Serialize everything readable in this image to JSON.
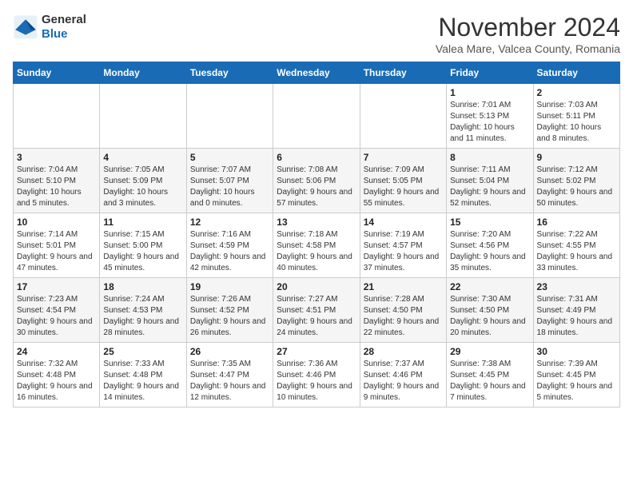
{
  "header": {
    "logo_line1": "General",
    "logo_line2": "Blue",
    "month_title": "November 2024",
    "location": "Valea Mare, Valcea County, Romania"
  },
  "weekdays": [
    "Sunday",
    "Monday",
    "Tuesday",
    "Wednesday",
    "Thursday",
    "Friday",
    "Saturday"
  ],
  "weeks": [
    [
      {
        "day": "",
        "info": ""
      },
      {
        "day": "",
        "info": ""
      },
      {
        "day": "",
        "info": ""
      },
      {
        "day": "",
        "info": ""
      },
      {
        "day": "",
        "info": ""
      },
      {
        "day": "1",
        "info": "Sunrise: 7:01 AM\nSunset: 5:13 PM\nDaylight: 10 hours and 11 minutes."
      },
      {
        "day": "2",
        "info": "Sunrise: 7:03 AM\nSunset: 5:11 PM\nDaylight: 10 hours and 8 minutes."
      }
    ],
    [
      {
        "day": "3",
        "info": "Sunrise: 7:04 AM\nSunset: 5:10 PM\nDaylight: 10 hours and 5 minutes."
      },
      {
        "day": "4",
        "info": "Sunrise: 7:05 AM\nSunset: 5:09 PM\nDaylight: 10 hours and 3 minutes."
      },
      {
        "day": "5",
        "info": "Sunrise: 7:07 AM\nSunset: 5:07 PM\nDaylight: 10 hours and 0 minutes."
      },
      {
        "day": "6",
        "info": "Sunrise: 7:08 AM\nSunset: 5:06 PM\nDaylight: 9 hours and 57 minutes."
      },
      {
        "day": "7",
        "info": "Sunrise: 7:09 AM\nSunset: 5:05 PM\nDaylight: 9 hours and 55 minutes."
      },
      {
        "day": "8",
        "info": "Sunrise: 7:11 AM\nSunset: 5:04 PM\nDaylight: 9 hours and 52 minutes."
      },
      {
        "day": "9",
        "info": "Sunrise: 7:12 AM\nSunset: 5:02 PM\nDaylight: 9 hours and 50 minutes."
      }
    ],
    [
      {
        "day": "10",
        "info": "Sunrise: 7:14 AM\nSunset: 5:01 PM\nDaylight: 9 hours and 47 minutes."
      },
      {
        "day": "11",
        "info": "Sunrise: 7:15 AM\nSunset: 5:00 PM\nDaylight: 9 hours and 45 minutes."
      },
      {
        "day": "12",
        "info": "Sunrise: 7:16 AM\nSunset: 4:59 PM\nDaylight: 9 hours and 42 minutes."
      },
      {
        "day": "13",
        "info": "Sunrise: 7:18 AM\nSunset: 4:58 PM\nDaylight: 9 hours and 40 minutes."
      },
      {
        "day": "14",
        "info": "Sunrise: 7:19 AM\nSunset: 4:57 PM\nDaylight: 9 hours and 37 minutes."
      },
      {
        "day": "15",
        "info": "Sunrise: 7:20 AM\nSunset: 4:56 PM\nDaylight: 9 hours and 35 minutes."
      },
      {
        "day": "16",
        "info": "Sunrise: 7:22 AM\nSunset: 4:55 PM\nDaylight: 9 hours and 33 minutes."
      }
    ],
    [
      {
        "day": "17",
        "info": "Sunrise: 7:23 AM\nSunset: 4:54 PM\nDaylight: 9 hours and 30 minutes."
      },
      {
        "day": "18",
        "info": "Sunrise: 7:24 AM\nSunset: 4:53 PM\nDaylight: 9 hours and 28 minutes."
      },
      {
        "day": "19",
        "info": "Sunrise: 7:26 AM\nSunset: 4:52 PM\nDaylight: 9 hours and 26 minutes."
      },
      {
        "day": "20",
        "info": "Sunrise: 7:27 AM\nSunset: 4:51 PM\nDaylight: 9 hours and 24 minutes."
      },
      {
        "day": "21",
        "info": "Sunrise: 7:28 AM\nSunset: 4:50 PM\nDaylight: 9 hours and 22 minutes."
      },
      {
        "day": "22",
        "info": "Sunrise: 7:30 AM\nSunset: 4:50 PM\nDaylight: 9 hours and 20 minutes."
      },
      {
        "day": "23",
        "info": "Sunrise: 7:31 AM\nSunset: 4:49 PM\nDaylight: 9 hours and 18 minutes."
      }
    ],
    [
      {
        "day": "24",
        "info": "Sunrise: 7:32 AM\nSunset: 4:48 PM\nDaylight: 9 hours and 16 minutes."
      },
      {
        "day": "25",
        "info": "Sunrise: 7:33 AM\nSunset: 4:48 PM\nDaylight: 9 hours and 14 minutes."
      },
      {
        "day": "26",
        "info": "Sunrise: 7:35 AM\nSunset: 4:47 PM\nDaylight: 9 hours and 12 minutes."
      },
      {
        "day": "27",
        "info": "Sunrise: 7:36 AM\nSunset: 4:46 PM\nDaylight: 9 hours and 10 minutes."
      },
      {
        "day": "28",
        "info": "Sunrise: 7:37 AM\nSunset: 4:46 PM\nDaylight: 9 hours and 9 minutes."
      },
      {
        "day": "29",
        "info": "Sunrise: 7:38 AM\nSunset: 4:45 PM\nDaylight: 9 hours and 7 minutes."
      },
      {
        "day": "30",
        "info": "Sunrise: 7:39 AM\nSunset: 4:45 PM\nDaylight: 9 hours and 5 minutes."
      }
    ]
  ]
}
